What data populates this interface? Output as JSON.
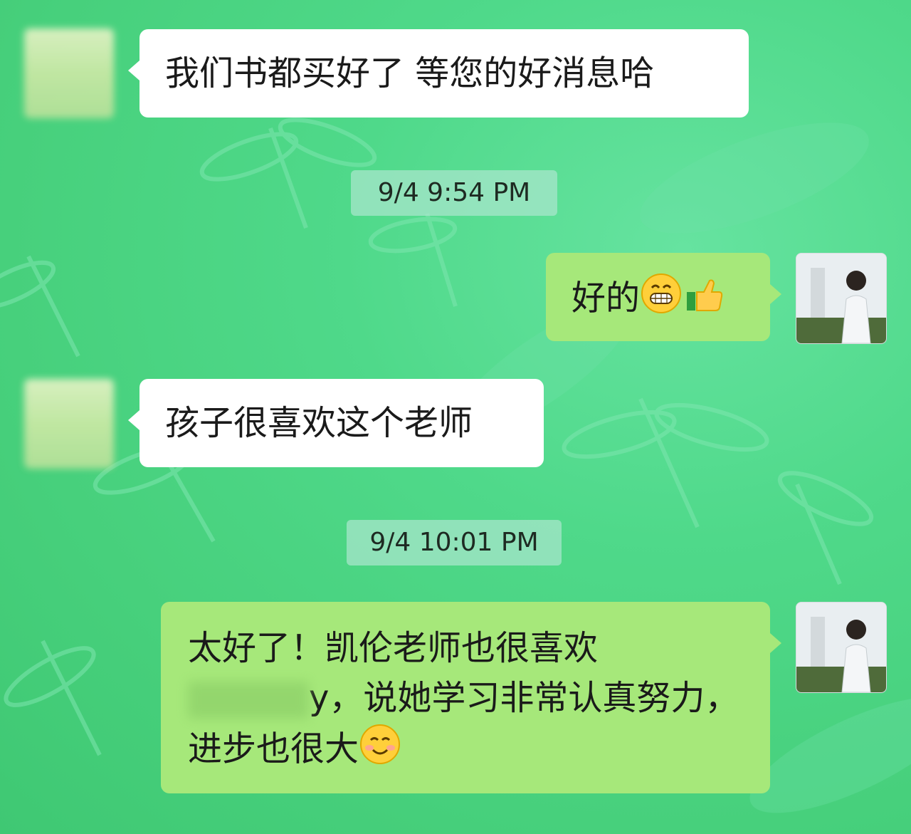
{
  "messages": [
    {
      "id": "m1",
      "side": "in",
      "text": "我们书都买好了 等您的好消息哈"
    },
    {
      "id": "t1",
      "type": "timestamp",
      "text": "9/4 9:54 PM"
    },
    {
      "id": "m2",
      "side": "out",
      "text": "好的",
      "emoji": [
        "grinning-face-emoji",
        "thumbs-up-emoji"
      ]
    },
    {
      "id": "m3",
      "side": "in",
      "text": "孩子很喜欢这个老师"
    },
    {
      "id": "t2",
      "type": "timestamp",
      "text": "9/4 10:01 PM"
    },
    {
      "id": "m4",
      "side": "out",
      "line1": "太好了！凯伦老师也很喜欢",
      "line2_tail": "y，说她学习非常认真努力，",
      "line3": "进步也很大",
      "emoji": [
        "smiling-face-emoji"
      ]
    }
  ],
  "colors": {
    "wallpaper": "#4fd98a",
    "incoming_bubble": "#ffffff",
    "outgoing_bubble": "#a6e87a",
    "timestamp_bg": "#aae6cd"
  }
}
